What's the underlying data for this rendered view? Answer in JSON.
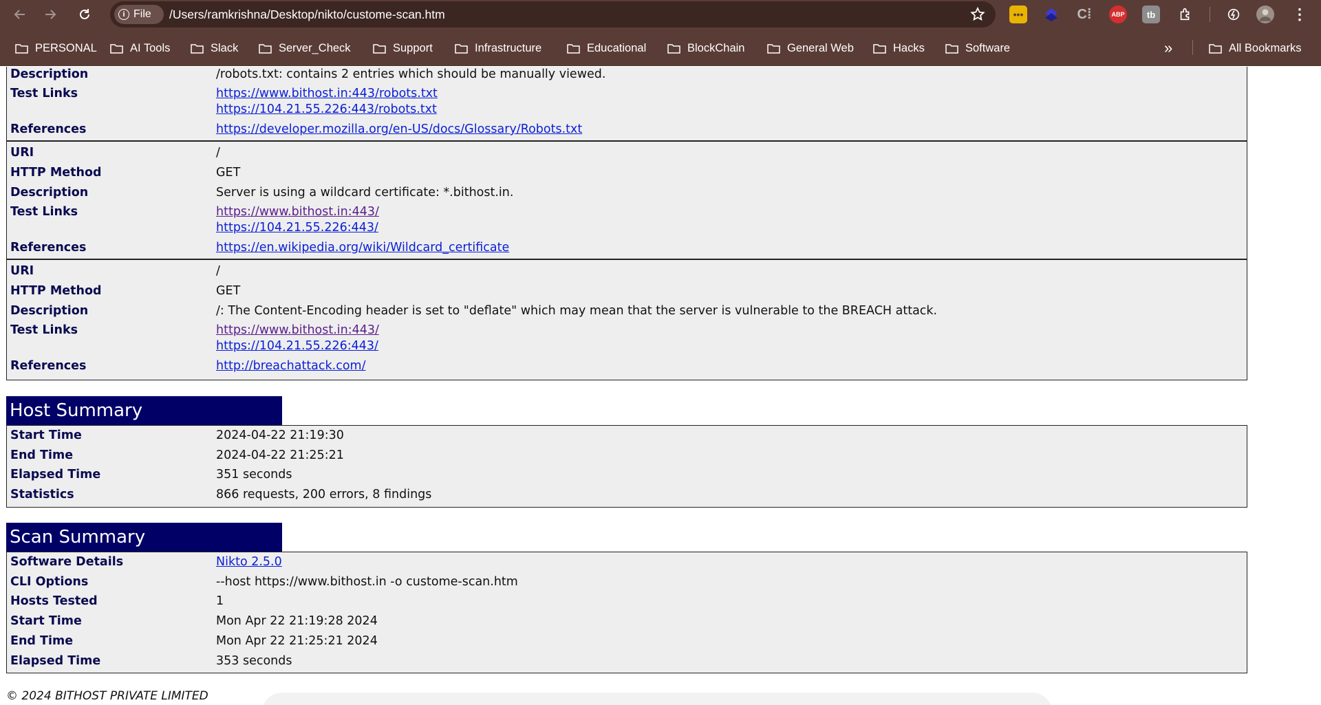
{
  "browser": {
    "chip_label": "File",
    "url": "/Users/ramkrishna/Desktop/nikto/custome-scan.htm",
    "extensions": [
      "keep-icon",
      "layers-icon",
      "c-icon",
      "ABP",
      "tb-icon"
    ],
    "abp_label": "ABP",
    "bookmarks": [
      "PERSONAL",
      "AI Tools",
      "Slack",
      "Server_Check",
      "Support",
      "Infrastructure",
      "Educational",
      "BlockChain",
      "General Web",
      "Hacks",
      "Software"
    ],
    "overflow": "»",
    "all_bookmarks": "All Bookmarks"
  },
  "findings": [
    {
      "description": "/robots.txt: contains 2 entries which should be manually viewed.",
      "test_links": [
        "https://www.bithost.in:443/robots.txt",
        "https://104.21.55.226:443/robots.txt"
      ],
      "references": "https://developer.mozilla.org/en-US/docs/Glossary/Robots.txt"
    },
    {
      "uri": "/",
      "http_method": "GET",
      "description": "Server is using a wildcard certificate: *.bithost.in.",
      "test_links": [
        "https://www.bithost.in:443/",
        "https://104.21.55.226:443/"
      ],
      "references": "https://en.wikipedia.org/wiki/Wildcard_certificate"
    },
    {
      "uri": "/",
      "http_method": "GET",
      "description": "/: The Content-Encoding header is set to \"deflate\" which may mean that the server is vulnerable to the BREACH attack.",
      "test_links": [
        "https://www.bithost.in:443/",
        "https://104.21.55.226:443/"
      ],
      "references": "http://breachattack.com/"
    }
  ],
  "labels": {
    "uri": "URI",
    "http_method": "HTTP Method",
    "description": "Description",
    "test_links": "Test Links",
    "references": "References",
    "start_time": "Start Time",
    "end_time": "End Time",
    "elapsed_time": "Elapsed Time",
    "statistics": "Statistics",
    "software_details": "Software Details",
    "cli_options": "CLI Options",
    "hosts_tested": "Hosts Tested"
  },
  "host_summary": {
    "title": "Host Summary",
    "start_time": "2024-04-22 21:19:30",
    "end_time": "2024-04-22 21:25:21",
    "elapsed_time": "351 seconds",
    "statistics": "866 requests, 200 errors, 8 findings"
  },
  "scan_summary": {
    "title": "Scan Summary",
    "software_details": "Nikto 2.5.0",
    "cli_options": "--host https://www.bithost.in -o custome-scan.htm",
    "hosts_tested": "1",
    "start_time": "Mon Apr 22 21:19:28 2024",
    "end_time": "Mon Apr 22 21:25:21 2024",
    "elapsed_time": "353 seconds"
  },
  "footer": "© 2024 BITHOST PRIVATE LIMITED"
}
